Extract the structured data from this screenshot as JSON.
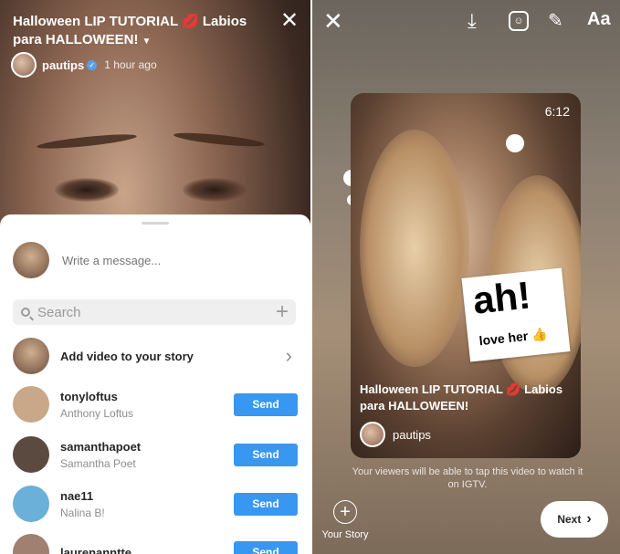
{
  "left": {
    "title": "Halloween LIP TUTORIAL 💋 Labios para HALLOWEEN!",
    "username": "pautips",
    "time": "1 hour ago",
    "message_placeholder": "Write a message...",
    "search_placeholder": "Search",
    "story_row_label": "Add video to your story",
    "contacts": [
      {
        "username": "tonyloftus",
        "name": "Anthony Loftus",
        "button": "Send",
        "color": "#c8a888"
      },
      {
        "username": "samanthapoet",
        "name": "Samantha Poet",
        "button": "Send",
        "color": "#5a4a40"
      },
      {
        "username": "nae11",
        "name": "Nalina B!",
        "button": "Send",
        "color": "#6ab0d8"
      },
      {
        "username": "laurenanntte",
        "name": "",
        "button": "Send",
        "color": "#a08070"
      }
    ]
  },
  "right": {
    "text_tool": "Aa",
    "duration": "6:12",
    "sticker_big": "ah!",
    "sticker_small": "love her 👍",
    "card_title": "Halloween LIP TUTORIAL 💋 Labios para HALLOWEEN!",
    "card_username": "pautips",
    "hint": "Your viewers will be able to tap this video to watch it on IGTV.",
    "your_story_label": "Your Story",
    "next_label": "Next"
  },
  "colors": {
    "send": "#3897f0",
    "verified": "#5aa0e8"
  }
}
